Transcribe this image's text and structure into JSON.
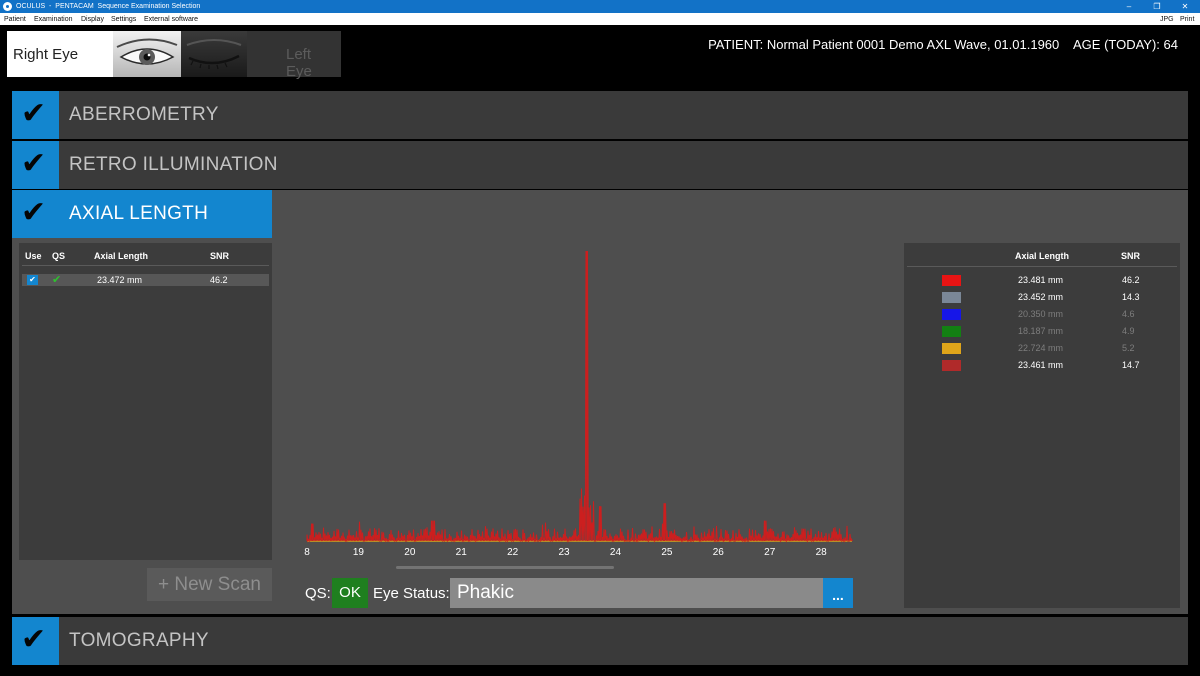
{
  "window": {
    "title": "OCULUS  -  PENTACAM  Sequence Examination Selection",
    "controls": {
      "minimize": "–",
      "restore": "❐",
      "close": "✕"
    }
  },
  "menu": {
    "items": [
      "Patient",
      "Examination",
      "Display",
      "Settings",
      "External software"
    ],
    "right_items": [
      "JPG",
      "Print"
    ]
  },
  "eye_selector": {
    "right_label": "Right Eye",
    "left_label": "Left Eye",
    "selected": "right"
  },
  "patient": {
    "info": "PATIENT: Normal Patient 0001 Demo AXL Wave, 01.01.1960",
    "age": "AGE (TODAY): 64"
  },
  "sections": {
    "check_glyph": "✔",
    "aberrometry": "ABERROMETRY",
    "retro_illumination": "RETRO ILLUMINATION",
    "axial_length": "AXIAL LENGTH",
    "tomography": "TOMOGRAPHY"
  },
  "measurements": {
    "headers": {
      "use": "Use",
      "qs": "QS",
      "axial_length": "Axial Length",
      "snr": "SNR"
    },
    "rows": [
      {
        "use_mark": "✔",
        "qs_mark": "✔",
        "axial_length": "23.472 mm",
        "snr": "46.2"
      }
    ]
  },
  "new_scan_label": "+ New Scan",
  "chart_data": {
    "type": "line",
    "x_ticks": [
      "8",
      "19",
      "20",
      "21",
      "22",
      "23",
      "24",
      "25",
      "26",
      "27",
      "28"
    ],
    "xlim": [
      18,
      28.6
    ],
    "baseline_color": "#d9a61c",
    "series": [
      {
        "color": "#cc1f1f",
        "peaks": [
          {
            "x": 23.45,
            "y": 100
          },
          {
            "x": 23.7,
            "y": 12
          },
          {
            "x": 24.95,
            "y": 13
          },
          {
            "x": 20.45,
            "y": 7
          },
          {
            "x": 26.9,
            "y": 7
          },
          {
            "x": 18.1,
            "y": 6
          }
        ]
      }
    ]
  },
  "eye_status": {
    "qs_label": "QS:",
    "qs_value": "OK",
    "label": "Eye Status:",
    "value": "Phakic",
    "more_label": "..."
  },
  "peaks_table": {
    "headers": {
      "axial_length": "Axial Length",
      "snr": "SNR"
    },
    "rows": [
      {
        "color": "#e81414",
        "axial_length": "23.481 mm",
        "snr": "46.2",
        "dim": false
      },
      {
        "color": "#7a8797",
        "axial_length": "23.452 mm",
        "snr": "14.3",
        "dim": false
      },
      {
        "color": "#1616e8",
        "axial_length": "20.350 mm",
        "snr": "4.6",
        "dim": true
      },
      {
        "color": "#138013",
        "axial_length": "18.187 mm",
        "snr": "4.9",
        "dim": true
      },
      {
        "color": "#dfa51a",
        "axial_length": "22.724 mm",
        "snr": "5.2",
        "dim": true
      },
      {
        "color": "#b02a2a",
        "axial_length": "23.461 mm",
        "snr": "14.7",
        "dim": false
      }
    ]
  }
}
